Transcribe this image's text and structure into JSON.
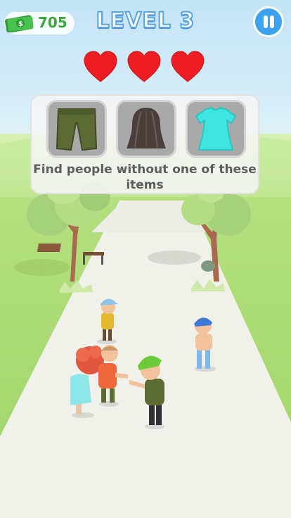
{
  "hud": {
    "money": "705",
    "level_title": "LEVEL 3",
    "lives": 3
  },
  "task": {
    "items": [
      {
        "name": "green shorts",
        "icon": "shorts-icon",
        "color": "#5b6b33"
      },
      {
        "name": "long hair",
        "icon": "hair-icon",
        "color": "#4a3f3c"
      },
      {
        "name": "cyan dress",
        "icon": "dress-icon",
        "color": "#3fe5e0"
      }
    ],
    "prompt": "Find people without one of these items"
  },
  "colors": {
    "heart": "#ee1d24",
    "pause": "#3aa2ef",
    "money_text": "#3aa83a",
    "level_outline": "#5aa4e0"
  }
}
